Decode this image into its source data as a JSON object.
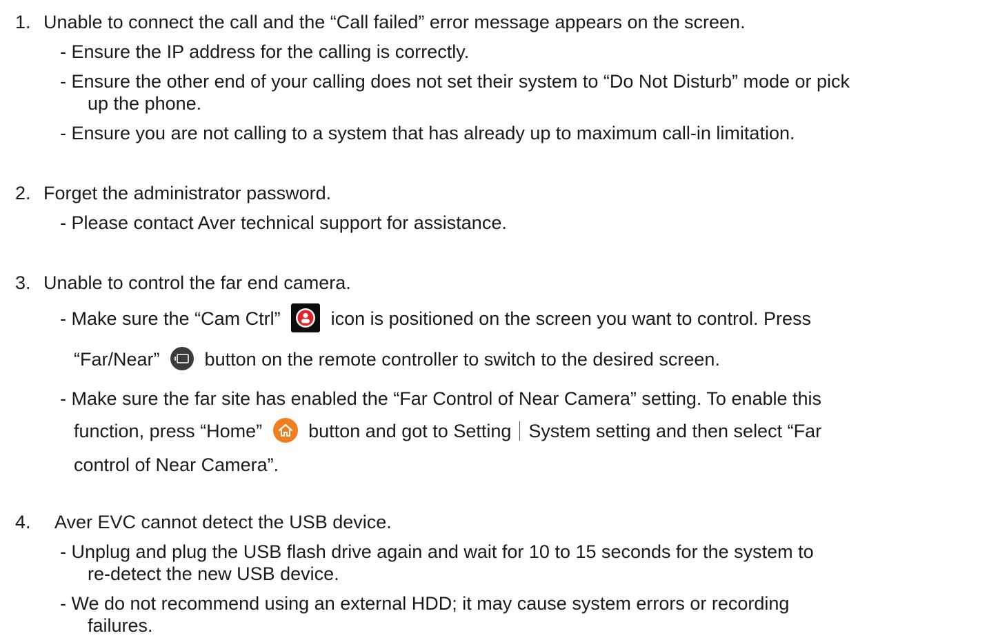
{
  "items": [
    {
      "number": "1.",
      "title": "Unable to connect the call and the “Call failed” error message appears on the screen.",
      "b1": "- Ensure the IP address for the calling is correctly.",
      "b2_l1": "- Ensure the other end of your calling does not set their system to “Do Not Disturb” mode or pick",
      "b2_l2": "up the phone.",
      "b3": "- Ensure you are not calling to a system that has already up to maximum call-in limitation."
    },
    {
      "number": "2.",
      "title": "Forget the administrator password.",
      "b1": "- Please contact Aver technical support for assistance."
    },
    {
      "number": "3.",
      "title": "Unable to control the far end camera.",
      "b1_pre": "- Make sure the “Cam Ctrl”",
      "b1_post": "icon is positioned on the screen you want to control. Press",
      "b1_l2_pre": "“Far/Near”",
      "b1_l2_post": "button on the remote controller to switch to the desired screen.",
      "b2_l1": "- Make sure the far site has enabled the “Far Control of Near Camera” setting. To enable this",
      "b2_l2_pre": "function, press “Home”",
      "b2_l2_mid": "button and got to Setting",
      "b2_l2_post": "System setting and then select “Far",
      "b2_l3": "control of Near Camera”."
    },
    {
      "number": "4.",
      "title": "Aver EVC cannot detect the USB device.",
      "b1_l1": "- Unplug and plug the USB flash drive again and wait for 10 to 15 seconds for the system to",
      "b1_l2": "re-detect the new USB device.",
      "b2_l1": "- We do not recommend using an external HDD; it may cause system errors or recording",
      "b2_l2": "failures."
    }
  ],
  "icons": {
    "cam_ctrl": "cam-ctrl-icon",
    "far_near": "far-near-icon",
    "home": "home-icon",
    "home_color": "#f07e1f",
    "cam_accent": "#e0242c"
  }
}
